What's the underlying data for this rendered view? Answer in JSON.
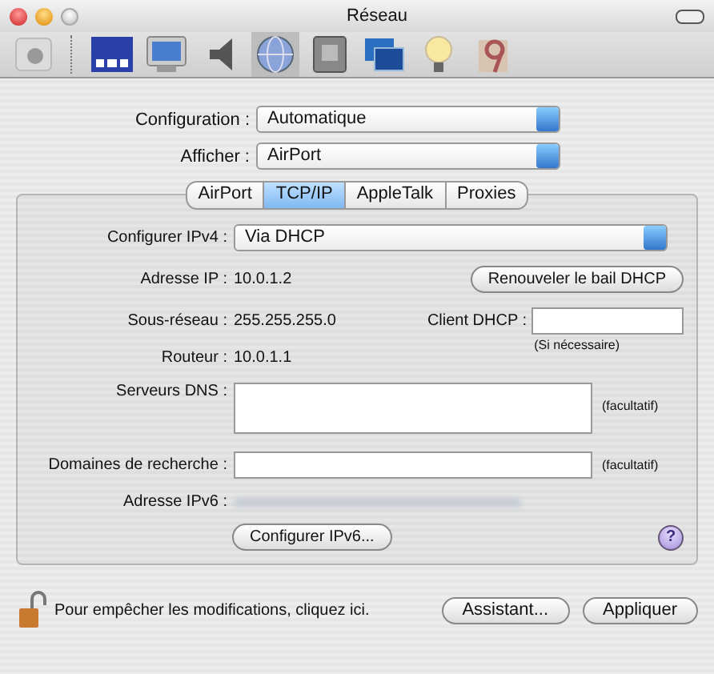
{
  "window": {
    "title": "Réseau"
  },
  "toolbar": [
    {
      "selected": false
    },
    {
      "selected": false
    },
    {
      "selected": false
    },
    {
      "selected": false
    },
    {
      "selected": true
    },
    {
      "selected": false
    },
    {
      "selected": false
    },
    {
      "selected": false
    },
    {
      "selected": false
    }
  ],
  "configuration": {
    "label": "Configuration :",
    "value": "Automatique"
  },
  "afficher": {
    "label": "Afficher :",
    "value": "AirPort"
  },
  "tabs": [
    {
      "label": "AirPort",
      "selected": false
    },
    {
      "label": "TCP/IP",
      "selected": true
    },
    {
      "label": "AppleTalk",
      "selected": false
    },
    {
      "label": "Proxies",
      "selected": false
    }
  ],
  "configurer_ipv4": {
    "label": "Configurer IPv4 :",
    "value": "Via DHCP"
  },
  "adresse_ip": {
    "label": "Adresse IP :",
    "value": "10.0.1.2"
  },
  "renew_button": "Renouveler le bail DHCP",
  "sous_reseau": {
    "label": "Sous-réseau :",
    "value": "255.255.255.0"
  },
  "client_dhcp": {
    "label": "Client DHCP :",
    "hint": "(Si nécessaire)"
  },
  "routeur": {
    "label": "Routeur :",
    "value": "10.0.1.1"
  },
  "dns": {
    "label": "Serveurs DNS :",
    "note": "(facultatif)"
  },
  "domaines": {
    "label": "Domaines de recherche :",
    "note": "(facultatif)"
  },
  "ipv6": {
    "label": "Adresse IPv6 :"
  },
  "ipv6_button": "Configurer IPv6...",
  "help": "?",
  "lock_text": "Pour empêcher les modifications, cliquez ici.",
  "buttons": [
    "Assistant...",
    "Appliquer"
  ]
}
